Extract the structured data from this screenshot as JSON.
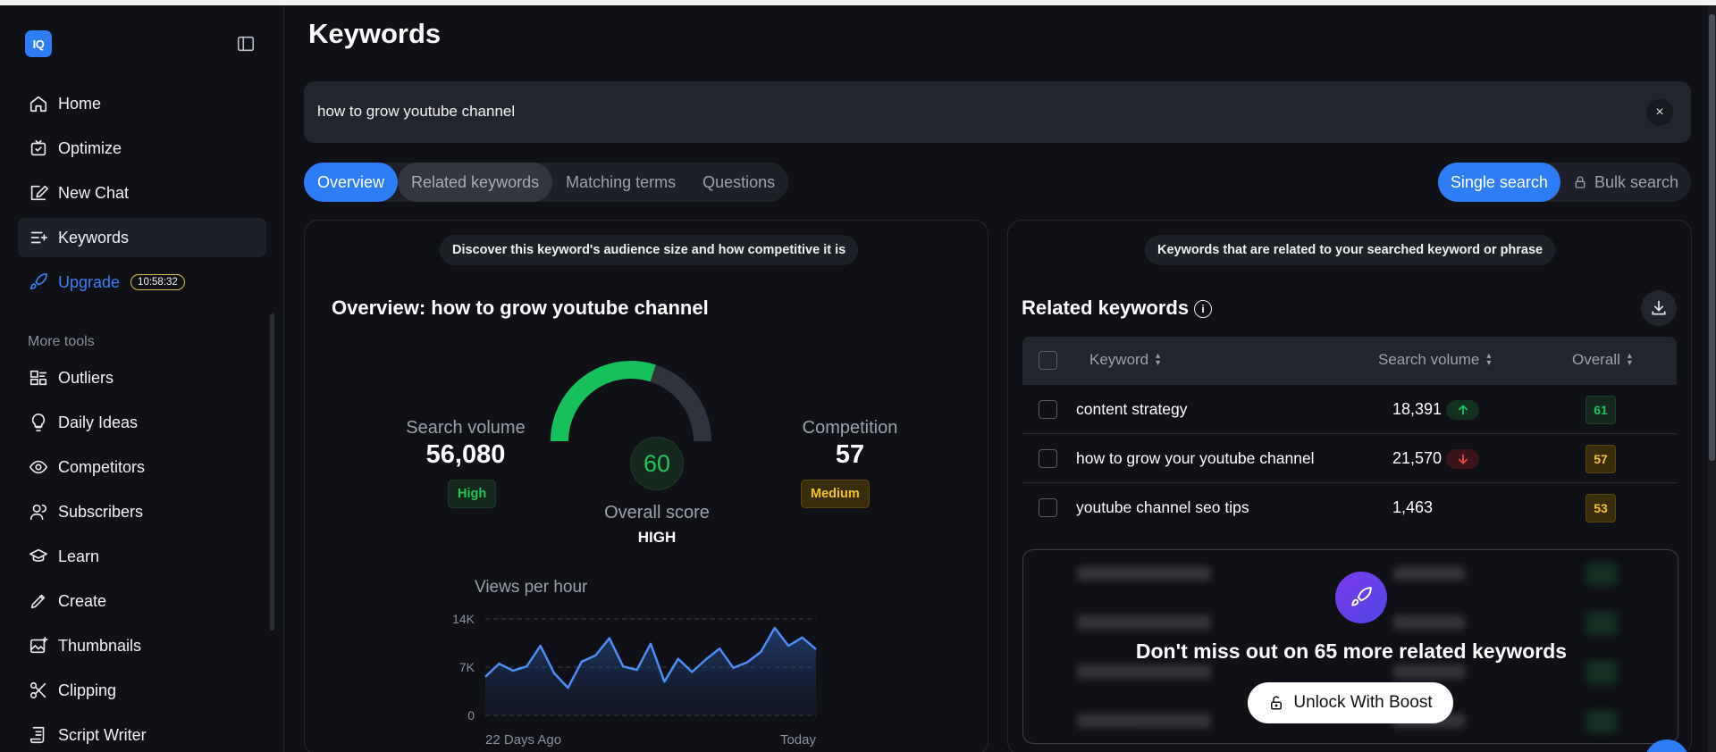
{
  "sidebar": {
    "logo_text": "IQ",
    "nav": [
      {
        "label": "Home",
        "icon": "home-icon"
      },
      {
        "label": "Optimize",
        "icon": "optimize-icon"
      },
      {
        "label": "New Chat",
        "icon": "edit-icon"
      },
      {
        "label": "Keywords",
        "icon": "keywords-icon",
        "active": true
      },
      {
        "label": "Upgrade",
        "icon": "rocket-icon",
        "timer": "10:58:32"
      }
    ],
    "more_tools_label": "More tools",
    "tools": [
      {
        "label": "Outliers",
        "icon": "outliers-icon"
      },
      {
        "label": "Daily Ideas",
        "icon": "lightbulb-icon"
      },
      {
        "label": "Competitors",
        "icon": "eye-icon"
      },
      {
        "label": "Subscribers",
        "icon": "user-icon"
      },
      {
        "label": "Learn",
        "icon": "graduation-cap-icon"
      },
      {
        "label": "Create",
        "icon": "pen-icon"
      },
      {
        "label": "Thumbnails",
        "icon": "image-icon"
      },
      {
        "label": "Clipping",
        "icon": "scissors-icon"
      },
      {
        "label": "Script Writer",
        "icon": "script-icon"
      }
    ]
  },
  "page": {
    "title": "Keywords",
    "search_value": "how to grow youtube channel",
    "clear_label": "×"
  },
  "tabs": [
    "Overview",
    "Related keywords",
    "Matching terms",
    "Questions"
  ],
  "mode_tabs": [
    "Single search",
    "Bulk search"
  ],
  "overview": {
    "pill": "Discover this keyword's audience size and how competitive it is",
    "heading": "Overview: how to grow youtube channel",
    "search_volume_label": "Search volume",
    "search_volume_value": "56,080",
    "search_volume_badge": "High",
    "competition_label": "Competition",
    "competition_value": "57",
    "competition_badge": "Medium",
    "score_value": "60",
    "score_fraction": 0.6,
    "score_label": "Overall score",
    "score_level": "HIGH",
    "colors": {
      "accent": "#2f7df6",
      "good": "#22c55e",
      "warn": "#f3c42b"
    }
  },
  "chart_data": {
    "type": "area",
    "title": "Views per hour",
    "x_tick_labels": [
      "22 Days Ago",
      "Today"
    ],
    "y_tick_labels": [
      "14K",
      "7K",
      "0"
    ],
    "ylim": [
      0,
      14000
    ],
    "grid": true,
    "series": [
      {
        "values": [
          5600,
          7500,
          6500,
          7100,
          10100,
          6100,
          4000,
          7800,
          8700,
          11200,
          7100,
          6600,
          10400,
          4900,
          8200,
          6300,
          8100,
          9700,
          6900,
          7700,
          9200,
          12700,
          10100,
          11300,
          9600
        ]
      }
    ]
  },
  "related": {
    "pill": "Keywords that are related to your searched keyword or phrase",
    "heading": "Related keywords",
    "columns": [
      "Keyword",
      "Search volume",
      "Overall"
    ],
    "rows": [
      {
        "keyword": "content strategy",
        "volume": "18,391",
        "trend": "up",
        "score": "61",
        "level": "green"
      },
      {
        "keyword": "how to grow your youtube channel",
        "volume": "21,570",
        "trend": "down",
        "score": "57",
        "level": "yellow"
      },
      {
        "keyword": "youtube channel seo tips",
        "volume": "1,463",
        "trend": "none",
        "score": "53",
        "level": "yellow"
      }
    ],
    "locked_text": "Don't miss out on 65 more related keywords",
    "unlock_label": "Unlock With Boost"
  }
}
